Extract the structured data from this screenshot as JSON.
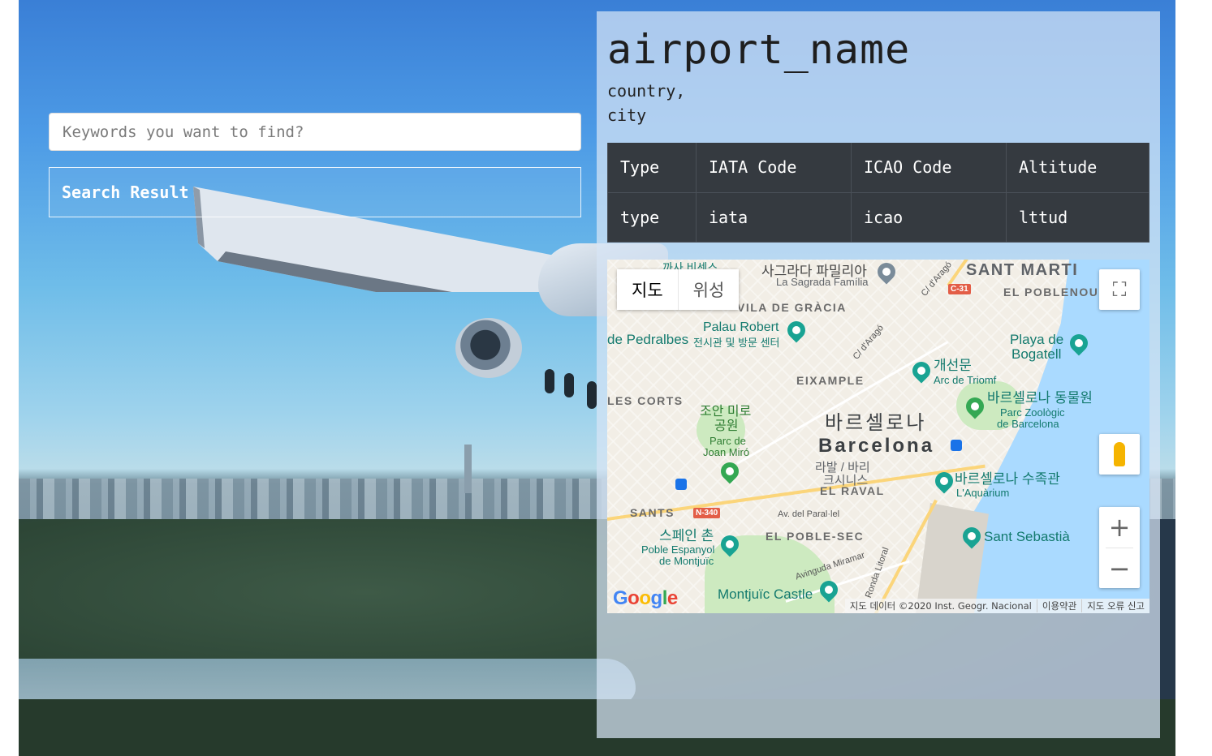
{
  "search": {
    "placeholder": "Keywords you want to find?",
    "value": ""
  },
  "results": {
    "title": "Search Result"
  },
  "airport": {
    "name": "airport_name",
    "country": "country,",
    "city": "city"
  },
  "info_table": {
    "headers": [
      "Type",
      "IATA Code",
      "ICAO Code",
      "Altitude"
    ],
    "row": [
      "type",
      "iata",
      "icao",
      "lttud"
    ]
  },
  "map": {
    "type_buttons": [
      "지도",
      "위성"
    ],
    "zoom_in": "+",
    "zoom_out": "−",
    "fullscreen_icon": "fullscreen-icon",
    "pegman_icon": "pegman-icon",
    "logo_letters": [
      "G",
      "o",
      "o",
      "g",
      "l",
      "e"
    ],
    "attribution": {
      "data": "지도 데이터 ©2020 Inst. Geogr. Nacional",
      "terms": "이용약관",
      "report": "지도 오류 신고"
    },
    "labels": {
      "sant_marti": "SANT MARTI",
      "el_poblenou": "EL POBLENOU",
      "gracia": "VILA DE GRÀCIA",
      "eixample": "EIXAMPLE",
      "les_corts": "LES CORTS",
      "sants": "SANTS",
      "el_poble_sec": "EL POBLE-SEC",
      "el_raval": "EL RAVAL",
      "sagrada_ko": "사그라다 파밀리아",
      "sagrada_en": "La Sagrada Família",
      "palau_robert_en": "Palau Robert",
      "palau_robert_ko": "전시관 및 방문 센터",
      "pedralbes": "de Pedralbes",
      "arc_ko": "개선문",
      "arc_en": "Arc de Triomf",
      "bogatell_1": "Playa de",
      "bogatell_2": "Bogatell",
      "zoo_ko": "바르셀로나 동물원",
      "zoo_en_1": "Parc Zoològic",
      "zoo_en_2": "de Barcelona",
      "miro_ko_1": "조안 미로",
      "miro_ko_2": "공원",
      "miro_en_1": "Parc de",
      "miro_en_2": "Joan Miró",
      "barcelona_ko": "바르셀로나",
      "barcelona_en": "Barcelona",
      "raval_ko_1": "라발 / 바리",
      "raval_ko_2": "크시니스",
      "aquarium_ko": "바르셀로나 수족관",
      "aquarium_en": "L'Aquàrium",
      "poble_espanyol_ko": "스페인 촌",
      "poble_espanyol_en_1": "Poble Espanyol",
      "poble_espanyol_en_2": "de Montjuïc",
      "santsebastia": "Sant Sebastià",
      "montjuic": "Montjuïc Castle",
      "c31": "C-31",
      "n340": "N-340",
      "parallel": "Av. del Paral·lel",
      "miramar": "Avinguda Miramar",
      "ronda": "Ronda Litoral",
      "arago_1": "C/ d'Aragó",
      "arago_2": "C/ d'Aragó",
      "top_cut": "까사 비센스"
    }
  },
  "colors": {
    "table_bg": "#353a40",
    "card_bg": "#d7e4f5",
    "sky": "#4d9be6"
  }
}
